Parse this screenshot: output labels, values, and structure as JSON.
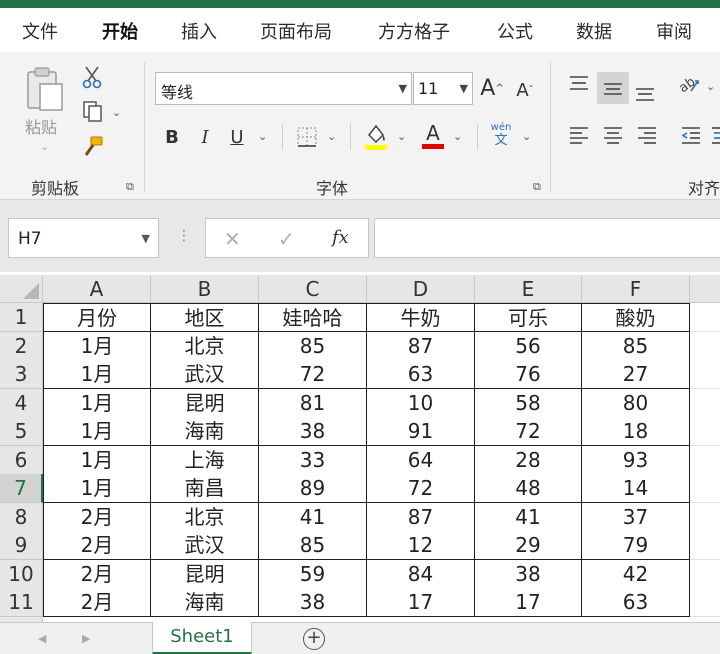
{
  "menu": {
    "tabs": [
      {
        "label": "文件",
        "active": false
      },
      {
        "label": "开始",
        "active": true
      },
      {
        "label": "插入",
        "active": false
      },
      {
        "label": "页面布局",
        "active": false
      },
      {
        "label": "方方格子",
        "active": false
      },
      {
        "label": "公式",
        "active": false
      },
      {
        "label": "数据",
        "active": false
      },
      {
        "label": "审阅",
        "active": false
      }
    ]
  },
  "ribbon": {
    "clipboard": {
      "label": "剪贴板",
      "paste_label": "粘贴",
      "icons": [
        "paste-icon",
        "cut-icon",
        "copy-icon",
        "format-painter-icon"
      ]
    },
    "font": {
      "label": "字体",
      "font_name": "等线",
      "font_size": "11",
      "grow_label": "A",
      "shrink_label": "A",
      "bold": "B",
      "italic": "I",
      "underline": "U",
      "font_color_glyph": "A",
      "phonetic_top": "wén",
      "phonetic_bottom": "文",
      "fill_color": "#ffff00",
      "font_color": "#e00000"
    },
    "alignment": {
      "label": "对齐"
    }
  },
  "formula_bar": {
    "name_box": "H7",
    "cancel_glyph": "✕",
    "enter_glyph": "✓",
    "fx_label": "fx",
    "formula": ""
  },
  "sheet": {
    "columns": [
      "A",
      "B",
      "C",
      "D",
      "E",
      "F"
    ],
    "rows": [
      {
        "n": "1",
        "cells": [
          "月份",
          "地区",
          "娃哈哈",
          "牛奶",
          "可乐",
          "酸奶"
        ]
      },
      {
        "n": "2",
        "cells": [
          "1月",
          "北京",
          "85",
          "87",
          "56",
          "85"
        ]
      },
      {
        "n": "3",
        "cells": [
          "1月",
          "武汉",
          "72",
          "63",
          "76",
          "27"
        ]
      },
      {
        "n": "4",
        "cells": [
          "1月",
          "昆明",
          "81",
          "10",
          "58",
          "80"
        ]
      },
      {
        "n": "5",
        "cells": [
          "1月",
          "海南",
          "38",
          "91",
          "72",
          "18"
        ]
      },
      {
        "n": "6",
        "cells": [
          "1月",
          "上海",
          "33",
          "64",
          "28",
          "93"
        ]
      },
      {
        "n": "7",
        "cells": [
          "1月",
          "南昌",
          "89",
          "72",
          "48",
          "14"
        ]
      },
      {
        "n": "8",
        "cells": [
          "2月",
          "北京",
          "41",
          "87",
          "41",
          "37"
        ]
      },
      {
        "n": "9",
        "cells": [
          "2月",
          "武汉",
          "85",
          "12",
          "29",
          "79"
        ]
      },
      {
        "n": "10",
        "cells": [
          "2月",
          "昆明",
          "59",
          "84",
          "38",
          "42"
        ]
      },
      {
        "n": "11",
        "cells": [
          "2月",
          "海南",
          "38",
          "17",
          "17",
          "63"
        ]
      }
    ],
    "selected_row": "7"
  },
  "tabs": {
    "sheet_name": "Sheet1",
    "add_glyph": "+"
  },
  "colors": {
    "accent": "#217346"
  }
}
